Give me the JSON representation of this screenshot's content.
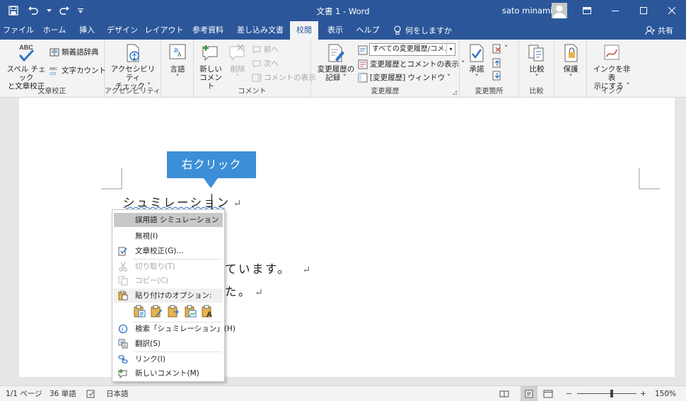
{
  "titlebar": {
    "title": "文書 1 - Word",
    "user": "sato minami"
  },
  "tabs": [
    {
      "label": "ファイル",
      "active": false
    },
    {
      "label": "ホーム",
      "active": false
    },
    {
      "label": "挿入",
      "active": false
    },
    {
      "label": "デザイン",
      "active": false
    },
    {
      "label": "レイアウト",
      "active": false
    },
    {
      "label": "参考資料",
      "active": false
    },
    {
      "label": "差し込み文書",
      "active": false
    },
    {
      "label": "校閲",
      "active": true
    },
    {
      "label": "表示",
      "active": false
    },
    {
      "label": "ヘルプ",
      "active": false
    }
  ],
  "tell_me": "何をしますか",
  "share": "共有",
  "ribbon": {
    "proofing": {
      "label": "文章校正",
      "spelling_line1": "スペル チェック",
      "spelling_line2": "と文章校正",
      "abc": "ABC",
      "thesaurus": "類義語辞典",
      "word_count": "文字カウント"
    },
    "accessibility": {
      "label": "アクセシビリティ",
      "check_line1": "アクセシビリティ",
      "check_line2": "チェック"
    },
    "language": {
      "label": "言語"
    },
    "comments": {
      "label": "コメント",
      "new_line1": "新しい",
      "new_line2": "コメント",
      "delete": "削除",
      "prev": "前へ",
      "next": "次へ",
      "show": "コメントの表示"
    },
    "tracking": {
      "label": "変更履歴",
      "track_line1": "変更履歴の",
      "track_line2": "記録",
      "markup_dropdown": "すべての変更履歴/コメ...",
      "show_markup": "変更履歴とコメントの表示",
      "pane": "[変更履歴] ウィンドウ"
    },
    "changes": {
      "label": "変更箇所",
      "accept": "承諾"
    },
    "compare": {
      "label": "比較",
      "compare": "比較"
    },
    "protect": {
      "label": "保護"
    },
    "ink": {
      "label": "インク",
      "hide_line1": "インクを非表",
      "hide_line2": "示にする"
    }
  },
  "document": {
    "line1": "シュミレーション",
    "line2_visible": "ています。",
    "line3_visible": "た。",
    "pilcrow": "↵"
  },
  "callout": {
    "text": "右クリック"
  },
  "context_menu": {
    "header": "誤用語  シミュレーション",
    "ignore": "無視(I)",
    "proofread": "文章校正(G)...",
    "cut": "切り取り(T)",
    "copy": "コピー(C)",
    "paste_options": "貼り付けのオプション:",
    "search": "検索「シュミレーション」(H)",
    "translate": "翻訳(S)",
    "link": "リンク(I)",
    "new_comment": "新しいコメント(M)"
  },
  "statusbar": {
    "page": "1/1 ページ",
    "words": "36 単語",
    "language": "日本語",
    "zoom": "150%",
    "zoom_fraction": 0.58
  },
  "colors": {
    "accent": "#2b579a",
    "callout": "#3c8fd6",
    "checkmark": "#2e75c7"
  }
}
